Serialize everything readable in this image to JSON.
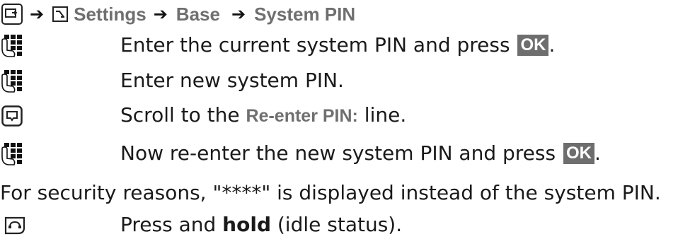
{
  "breadcrumb": {
    "items": [
      "Settings",
      "Base",
      "System PIN"
    ],
    "arrow": "➔"
  },
  "steps": [
    {
      "icon": "keypad-icon",
      "parts": [
        "Enter the current system PIN and press ",
        "OK",
        "."
      ]
    },
    {
      "icon": "keypad-icon",
      "parts": [
        "Enter new system PIN."
      ]
    },
    {
      "icon": "control-key-down-icon",
      "parts": [
        "Scroll to the ",
        "Re-enter PIN:",
        " line."
      ]
    },
    {
      "icon": "keypad-icon",
      "parts": [
        "Now re-enter the new system PIN and press ",
        "OK",
        "."
      ]
    }
  ],
  "note": "For security reasons, \"****\" is displayed instead of the system PIN.",
  "final_step": {
    "icon": "end-call-key-icon",
    "before": "Press and ",
    "bold": "hold",
    "after": " (idle status)."
  },
  "colors": {
    "text": "#1a1a1a",
    "menu_term": "#6f6f6f",
    "softkey_bg": "#6e6e6e"
  }
}
